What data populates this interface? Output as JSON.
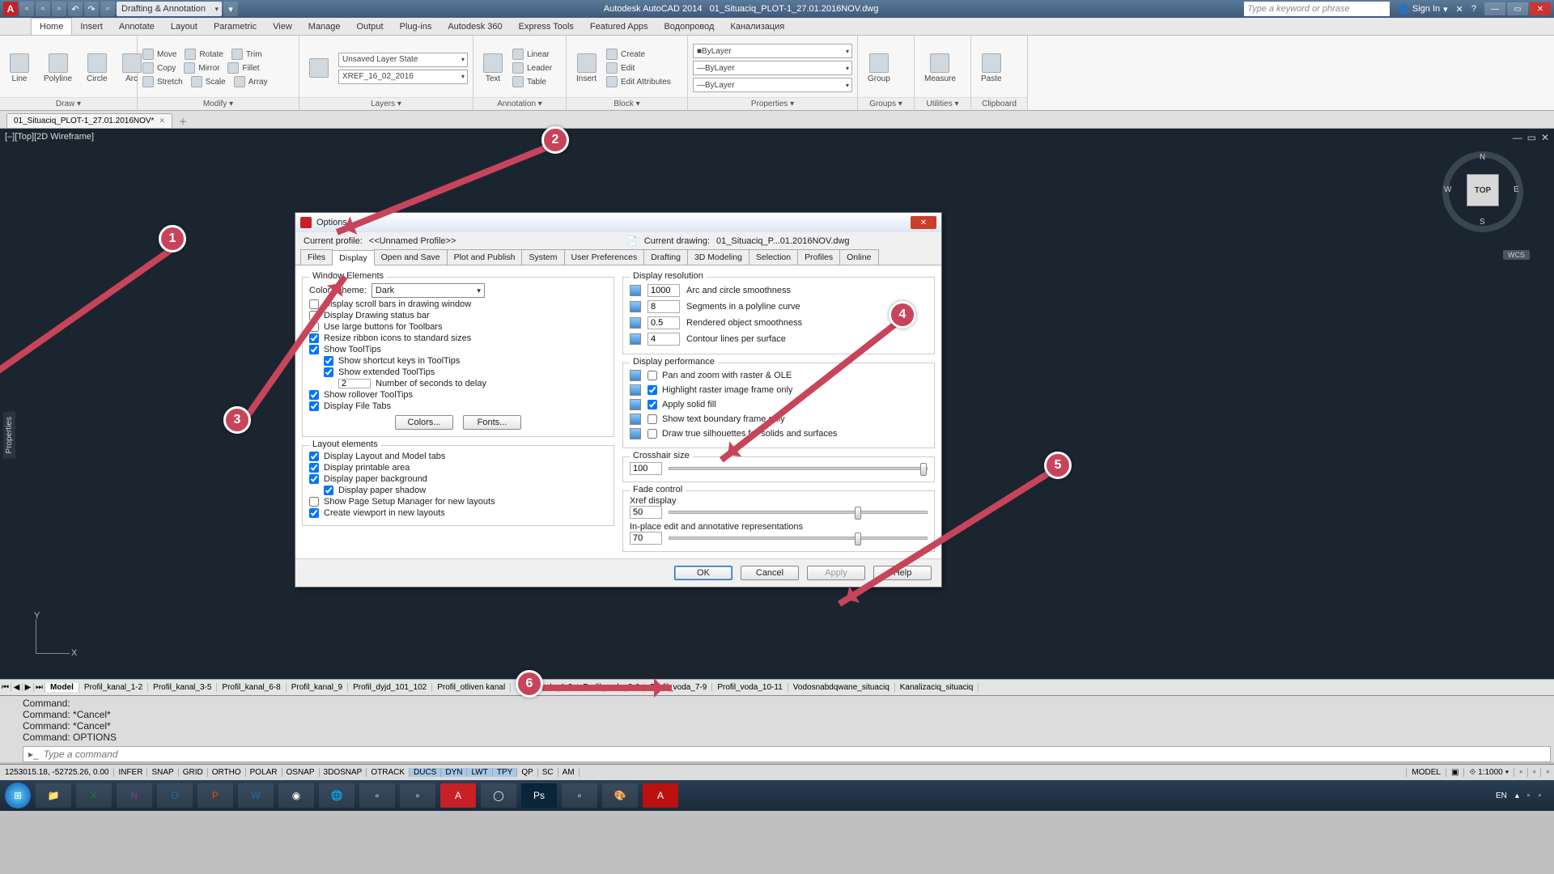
{
  "titlebar": {
    "workspace": "Drafting & Annotation",
    "app": "Autodesk AutoCAD 2014",
    "filename": "01_Situaciq_PLOT-1_27.01.2016NOV.dwg",
    "search_placeholder": "Type a keyword or phrase",
    "signin": "Sign In"
  },
  "ribbon_tabs": [
    "Home",
    "Insert",
    "Annotate",
    "Layout",
    "Parametric",
    "View",
    "Manage",
    "Output",
    "Plug-ins",
    "Autodesk 360",
    "Express Tools",
    "Featured Apps",
    "Водопровод",
    "Канализация"
  ],
  "ribbon_tabs_active": 0,
  "ribbon": {
    "draw": {
      "title": "Draw ▾",
      "items": [
        "Line",
        "Polyline",
        "Circle",
        "Arc"
      ]
    },
    "modify": {
      "title": "Modify ▾",
      "rows": [
        [
          "Move",
          "Rotate",
          "Trim"
        ],
        [
          "Copy",
          "Mirror",
          "Fillet"
        ],
        [
          "Stretch",
          "Scale",
          "Array"
        ]
      ]
    },
    "layers": {
      "title": "Layers ▾",
      "state": "Unsaved Layer State",
      "current": "XREF_16_02_2016"
    },
    "annotation": {
      "title": "Annotation ▾",
      "text": "Text",
      "rows": [
        "Linear",
        "Leader",
        "Table"
      ]
    },
    "block": {
      "title": "Block ▾",
      "insert": "Insert",
      "rows": [
        "Create",
        "Edit",
        "Edit Attributes"
      ]
    },
    "properties": {
      "title": "Properties ▾",
      "layer": "ByLayer",
      "lt": "ByLayer",
      "lw": "ByLayer"
    },
    "groups": {
      "title": "Groups ▾",
      "btn": "Group"
    },
    "utilities": {
      "title": "Utilities ▾",
      "btn": "Measure"
    },
    "clipboard": {
      "title": "Clipboard",
      "btn": "Paste"
    }
  },
  "filetab": "01_Situaciq_PLOT-1_27.01.2016NOV*",
  "view_label": "[–][Top][2D Wireframe]",
  "navcube": {
    "face": "TOP",
    "n": "N",
    "s": "S",
    "e": "E",
    "w": "W"
  },
  "wcs": "WCS",
  "side_panel": "Properties",
  "layout_tabs": [
    "Model",
    "Profil_kanal_1-2",
    "Profil_kanal_3-5",
    "Profil_kanal_6-8",
    "Profil_kanal_9",
    "Profil_dyjd_101_102",
    "Profil_otliven kanal",
    "Profil_voda_1-2",
    "Profil_voda_3-6",
    "Profil_voda_7-9",
    "Profil_voda_10-11",
    "Vodosnabdqwane_situaciq",
    "Kanalizaciq_situaciq"
  ],
  "layout_active": 0,
  "cmd_history": [
    "Command:",
    "Command: *Cancel*",
    "Command: *Cancel*",
    "Command: OPTIONS"
  ],
  "cmd_placeholder": "Type a command",
  "status": {
    "coords": "1253015.18, -52725.26, 0.00",
    "toggles": [
      "INFER",
      "SNAP",
      "GRID",
      "ORTHO",
      "POLAR",
      "OSNAP",
      "3DOSNAP",
      "OTRACK",
      "DUCS",
      "DYN",
      "LWT",
      "TPY",
      "QP",
      "SC",
      "AM"
    ],
    "toggles_on": [
      "DUCS",
      "DYN",
      "LWT",
      "TPY"
    ],
    "right": {
      "space": "MODEL",
      "scale": "1:1000 ▾"
    }
  },
  "dialog": {
    "title": "Options",
    "profile_lbl": "Current profile:",
    "profile_val": "<<Unnamed Profile>>",
    "drawing_lbl": "Current drawing:",
    "drawing_val": "01_Situaciq_P...01.2016NOV.dwg",
    "tabs": [
      "Files",
      "Display",
      "Open and Save",
      "Plot and Publish",
      "System",
      "User Preferences",
      "Drafting",
      "3D Modeling",
      "Selection",
      "Profiles",
      "Online"
    ],
    "tab_active": 1,
    "window_elements": {
      "legend": "Window Elements",
      "color_scheme_lbl": "Color scheme:",
      "color_scheme_val": "Dark",
      "scrollbars": "Display scroll bars in drawing window",
      "statusbar": "Display Drawing status bar",
      "large_buttons": "Use large buttons for Toolbars",
      "resize_icons": "Resize ribbon icons to standard sizes",
      "tooltips": "Show ToolTips",
      "shortcut_keys": "Show shortcut keys in ToolTips",
      "extended_tt": "Show extended ToolTips",
      "delay_val": "2",
      "delay_lbl": "Number of seconds to delay",
      "rollover": "Show rollover ToolTips",
      "filetabs": "Display File Tabs",
      "colors_btn": "Colors...",
      "fonts_btn": "Fonts..."
    },
    "layout_elements": {
      "legend": "Layout elements",
      "lm_tabs": "Display Layout and Model tabs",
      "printable": "Display printable area",
      "paper_bg": "Display paper background",
      "paper_shadow": "Display paper shadow",
      "page_setup": "Show Page Setup Manager for new layouts",
      "viewport": "Create viewport in new layouts"
    },
    "display_resolution": {
      "legend": "Display resolution",
      "arc_val": "1000",
      "arc_lbl": "Arc and circle smoothness",
      "seg_val": "8",
      "seg_lbl": "Segments in a polyline curve",
      "ren_val": "0.5",
      "ren_lbl": "Rendered object smoothness",
      "con_val": "4",
      "con_lbl": "Contour lines per surface"
    },
    "display_performance": {
      "legend": "Display performance",
      "pan": "Pan and zoom with raster & OLE",
      "hilite": "Highlight raster image frame only",
      "solid": "Apply solid fill",
      "textbound": "Show text boundary frame only",
      "silhouette": "Draw true silhouettes for solids and surfaces"
    },
    "crosshair": {
      "legend": "Crosshair size",
      "val": "100"
    },
    "fade": {
      "legend": "Fade control",
      "xref_lbl": "Xref display",
      "xref_val": "50",
      "inplace_lbl": "In-place edit and annotative representations",
      "inplace_val": "70"
    },
    "buttons": {
      "ok": "OK",
      "cancel": "Cancel",
      "apply": "Apply",
      "help": "Help"
    }
  },
  "markers": [
    "1",
    "2",
    "3",
    "4",
    "5",
    "6"
  ],
  "taskbar": {
    "lang": "EN",
    "time": ""
  }
}
